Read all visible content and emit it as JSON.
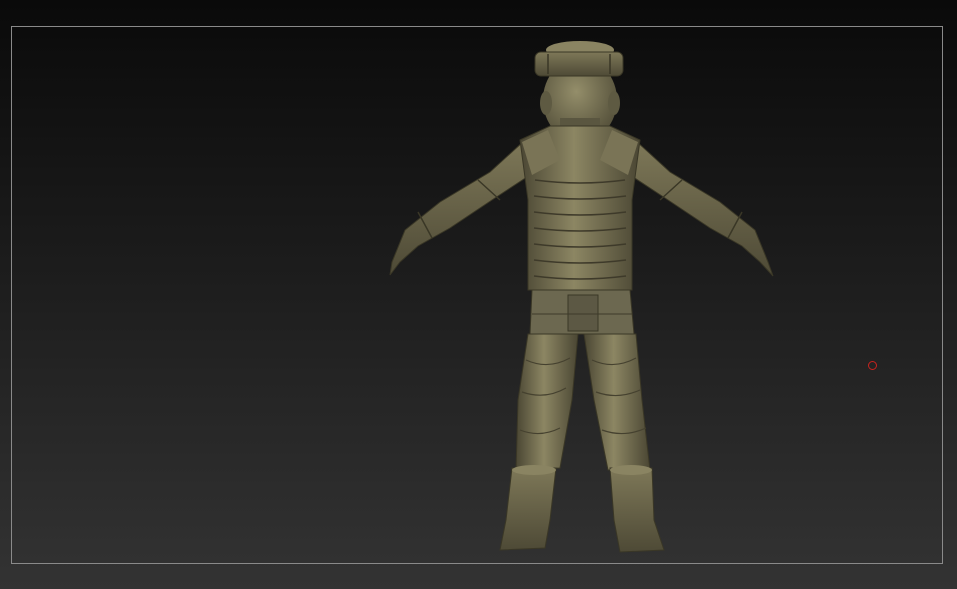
{
  "viewport": {
    "background_top": "#0a0a0a",
    "background_bottom": "#333333",
    "frame_color": "#8a8a8a"
  },
  "model": {
    "material_base": "#6e6a50",
    "material_light": "#9a9470",
    "material_dark": "#3e3b2a",
    "view": "back"
  },
  "cursor": {
    "shape": "circle-cursor",
    "color": "#c8231e"
  }
}
